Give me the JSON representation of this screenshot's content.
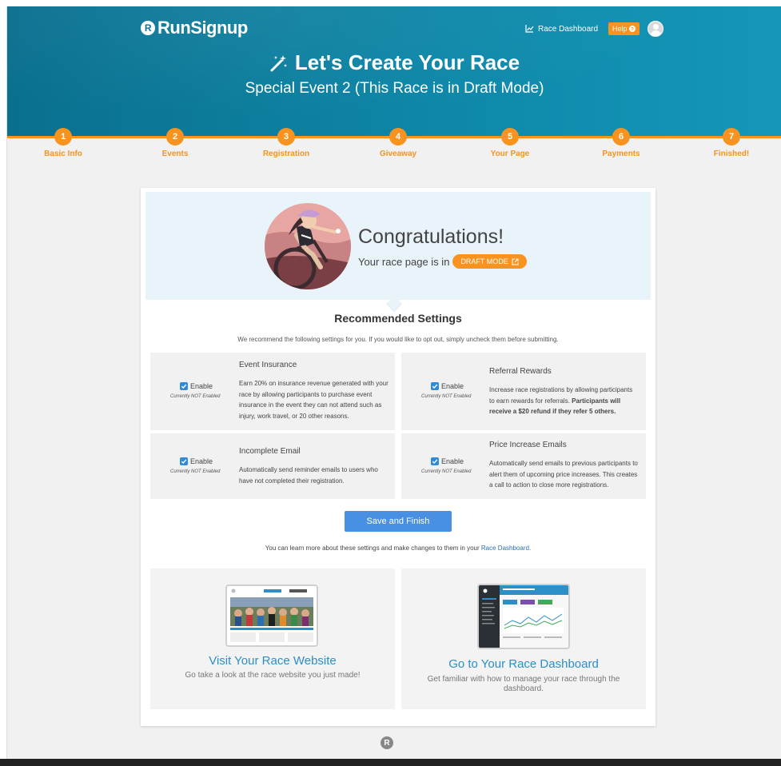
{
  "brand": {
    "name": "RunSignup",
    "logo_letter": "R"
  },
  "topnav": {
    "dashboard_label": "Race Dashboard",
    "help_label": "Help"
  },
  "hero": {
    "title": "Let's Create Your Race",
    "subtitle": "Special Event 2 (This Race is in Draft Mode)"
  },
  "steps": [
    {
      "num": "1",
      "label": "Basic Info"
    },
    {
      "num": "2",
      "label": "Events"
    },
    {
      "num": "3",
      "label": "Registration"
    },
    {
      "num": "4",
      "label": "Giveaway"
    },
    {
      "num": "5",
      "label": "Your Page"
    },
    {
      "num": "6",
      "label": "Payments"
    },
    {
      "num": "7",
      "label": "Finished!"
    }
  ],
  "congrats": {
    "title": "Congratulations!",
    "line": "Your race page is in",
    "badge": "DRAFT MODE"
  },
  "recommended": {
    "title": "Recommended Settings",
    "subtitle": "We recommend the following settings for you. If you would like to opt out, simply uncheck them before submitting.",
    "options": [
      {
        "enable_label": "Enable",
        "note": "Currently NOT Enabled",
        "title": "Event Insurance",
        "desc": "Earn 20% on insurance revenue generated with your race by allowing participants to purchase event insurance in the event they can not attend such as injury, work travel, or 20 other reasons.",
        "checked": true
      },
      {
        "enable_label": "Enable",
        "note": "Currently NOT Enabled",
        "title": "Referral Rewards",
        "desc": "Increase race registrations by allowing participants to earn rewards for referrals.",
        "desc_bold": "Participants will receive a $20 refund if they refer 5 others.",
        "checked": true
      },
      {
        "enable_label": "Enable",
        "note": "Currently NOT Enabled",
        "title": "Incomplete Email",
        "desc": "Automatically send reminder emails to users who have not completed their registration.",
        "checked": true
      },
      {
        "enable_label": "Enable",
        "note": "Currently NOT Enabled",
        "title": "Price Increase Emails",
        "desc": "Automatically send emails to previous participants to alert them of upcoming price increases. This creates a call to action to close more registrations.",
        "checked": true
      }
    ]
  },
  "save_label": "Save and Finish",
  "learn": {
    "text": "You can learn more about these settings and make changes to them in your",
    "link": "Race Dashboard",
    "suffix": "."
  },
  "promos": [
    {
      "title": "Visit Your Race Website",
      "desc": "Go take a look at the race website you just made!"
    },
    {
      "title": "Go to Your Race Dashboard",
      "desc": "Get familiar with how to manage your race through the dashboard."
    }
  ],
  "colors": {
    "accent": "#f7931e",
    "hero": "#0e87a8",
    "link": "#2a8fc7",
    "button": "#4a90e2"
  }
}
